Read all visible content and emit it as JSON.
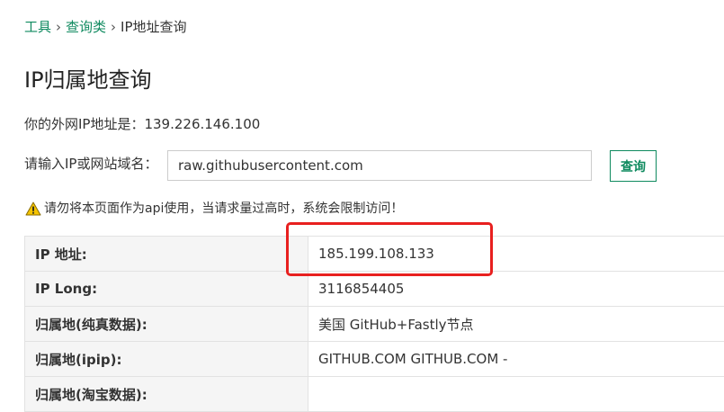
{
  "breadcrumb": {
    "items": [
      "工具",
      "查询类"
    ],
    "separator": "›",
    "current": "IP地址查询"
  },
  "page": {
    "title": "IP归属地查询"
  },
  "my_ip": {
    "text": "你的外网IP地址是：139.226.146.100"
  },
  "query": {
    "label": "请输入IP或网站域名：",
    "value": "raw.githubusercontent.com",
    "button_label": "查询"
  },
  "notice": {
    "icon": "warning-icon",
    "text": "请勿将本页面作为api使用，当请求量过高时，系统会限制访问！"
  },
  "results": [
    {
      "label": "IP 地址:",
      "value": "185.199.108.133"
    },
    {
      "label": "IP Long:",
      "value": "3116854405"
    },
    {
      "label": "归属地(纯真数据):",
      "value": "美国 GitHub+Fastly节点"
    },
    {
      "label": "归属地(ipip):",
      "value": "GITHUB.COM GITHUB.COM -"
    },
    {
      "label": "归属地(淘宝数据):",
      "value": ""
    }
  ],
  "colors": {
    "link": "#0f8a5f",
    "highlight": "#e8201f",
    "warning": "#f5c400",
    "label_bg": "#f5f5f5"
  }
}
